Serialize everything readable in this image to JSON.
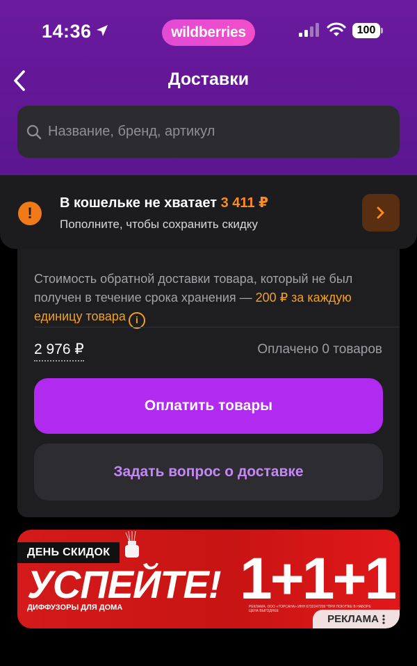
{
  "status_bar": {
    "time": "14:36",
    "brand": "wildberries",
    "battery": "100"
  },
  "header": {
    "title": "Доставки",
    "search_placeholder": "Название, бренд, артикул"
  },
  "wallet": {
    "title": "В кошельке не хватает",
    "amount": "3 411 ₽",
    "subtitle": "Пополните, чтобы сохранить скидку"
  },
  "delivery": {
    "description_main": "Стоимость обратной доставки товара, который не был получен в течение срока хранения —",
    "description_accent": "200 ₽ за каждую единицу товара",
    "price": "2 976 ₽",
    "paid_count": "Оплачено 0 товаров",
    "pay_button": "Оплатить товары",
    "ask_button": "Задать вопрос о доставке"
  },
  "ad": {
    "tag": "ДЕНЬ СКИДОК",
    "headline": "УСПЕЙТЕ!",
    "subtitle": "ДИФФУЗОРЫ ДЛЯ ДОМА",
    "promo": "1+1+1",
    "legal": "РЕКЛАМА. ООО «ТОРСАНА» ИНН 6732247209 *ПРИ ПОКУПКЕ В НАБОРЕ ЦЕНА ВЫГОДНЕЕ",
    "badge": "РЕКЛАМА"
  },
  "colors": {
    "header_bg": "#6a1a9e",
    "brand_pink": "#e24bd6",
    "accent_orange": "#ff8a1e",
    "pay_button": "#b12af0",
    "ask_text": "#c488f6",
    "ad_red": "#d41a1a"
  }
}
